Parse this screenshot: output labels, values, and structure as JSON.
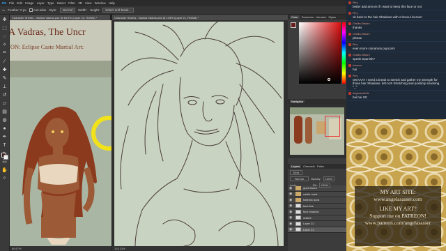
{
  "menubar": {
    "items": [
      "PS",
      "File",
      "Edit",
      "Image",
      "Layer",
      "Type",
      "Select",
      "Filter",
      "3D",
      "View",
      "Window",
      "Help"
    ]
  },
  "options": {
    "items": [
      "Feather: 0 px",
      "Anti-alias",
      "Style:",
      "Normal",
      "Width:",
      "Height:",
      "Select and Mask..."
    ]
  },
  "doc1": {
    "tab": "Character Sheets - Vadara Vadras.psd @ 66.6% (Layer 22, RGB/8) *",
    "title": "A Vadras, The Uncr",
    "subtitle": "ION: Eclipse Caste  Martial Art:",
    "status": "66.67%"
  },
  "doc2": {
    "tab": "Character Sheets - Vadara Vadras.psd @ 133% (Layer 21, RGB/8) *",
    "status": "133.33%"
  },
  "panels": {
    "color_tabs": [
      "Color",
      "Swatches",
      "Libraries",
      "Styles"
    ],
    "navigator_tab": "Navigator",
    "layers_tabs": [
      "Layers",
      "Channels",
      "Paths"
    ],
    "kind_label": "Kind",
    "blend_mode": "Normal",
    "opacity_label": "Opacity:",
    "opacity_value": "100%",
    "fill_label": "Fill:",
    "fill_value": "100%",
    "lock_label": "Lock:"
  },
  "layers": [
    {
      "name": "guidl board",
      "type": "folder"
    },
    {
      "name": "castle mark",
      "type": "folder"
    },
    {
      "name": "hatemic aura",
      "type": "folder"
    },
    {
      "name": "face line",
      "type": "layer"
    },
    {
      "name": "face shadow",
      "type": "layer"
    },
    {
      "name": "outline",
      "type": "layer"
    },
    {
      "name": "Layer 22",
      "type": "layer"
    },
    {
      "name": "Layer 21",
      "type": "layer"
    }
  ],
  "chat": [
    {
      "user": "Pirry",
      "text": "better add armors if I want to keep this face or not"
    },
    {
      "user": "Pirry",
      "text": "ok back to the hair Shadows with crimsoul locrser!"
    },
    {
      "user": "Cthulhu Bitcorn",
      "text": "thanks"
    },
    {
      "user": "Cthulhu Bitcorn",
      "text": "please"
    },
    {
      "user": "Pirry",
      "text": "even more cinnamon popcorn!"
    },
    {
      "user": "Cthulhu Bitcorn",
      "text": "speak Spanish?"
    },
    {
      "user": "Ictomun",
      "text": "hai"
    },
    {
      "user": "Pirry",
      "text": "OKAAAY I need a break to stretch and gather my strength for those hair Shadows. brb to!!! Stretching and possibly snacking. ^_^"
    },
    {
      "user": "droptweeterUk",
      "text": "bai bai XD"
    }
  ],
  "promo": {
    "line1": "MY ART SITE:",
    "line2": "www.angelasasser.com",
    "line3": "LIKE MY ART?",
    "line4": "Support me on PATREON!",
    "line5": "www.patreon.com/angelasasser"
  },
  "colors": {
    "chat_bg": "#1e2a38",
    "chat_user": "#e59a8a",
    "accent_red": "#c0392b",
    "canvas_green": "#c9d3c2",
    "promo_gold": "#c9a44e"
  }
}
